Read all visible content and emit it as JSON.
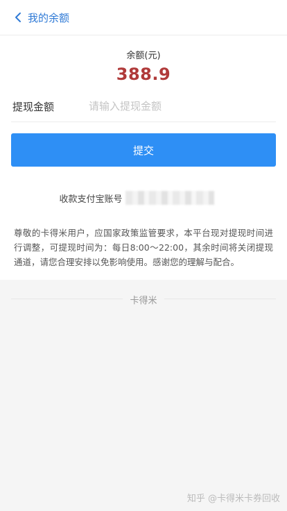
{
  "header": {
    "back_label": "我的余额"
  },
  "balance": {
    "label": "余额(元)",
    "value": "388.9"
  },
  "withdraw": {
    "label": "提现金额",
    "placeholder": "请输入提现金额"
  },
  "submit": {
    "label": "提交"
  },
  "alipay": {
    "label": "收款支付宝账号"
  },
  "notice": {
    "text": "尊敬的卡得米用户，应国家政策监管要求，本平台现对提现时间进行调整，可提现时间为：每日8:00～22:00，其余时间将关闭提现通道，请您合理安排以免影响使用。感谢您的理解与配合。"
  },
  "footer": {
    "brand": "卡得米"
  },
  "watermark": {
    "text": "知乎 @卡得米卡券回收"
  },
  "colors": {
    "accent": "#2e8ff5",
    "balance": "#b03a3a",
    "link": "#2f7ad6"
  }
}
